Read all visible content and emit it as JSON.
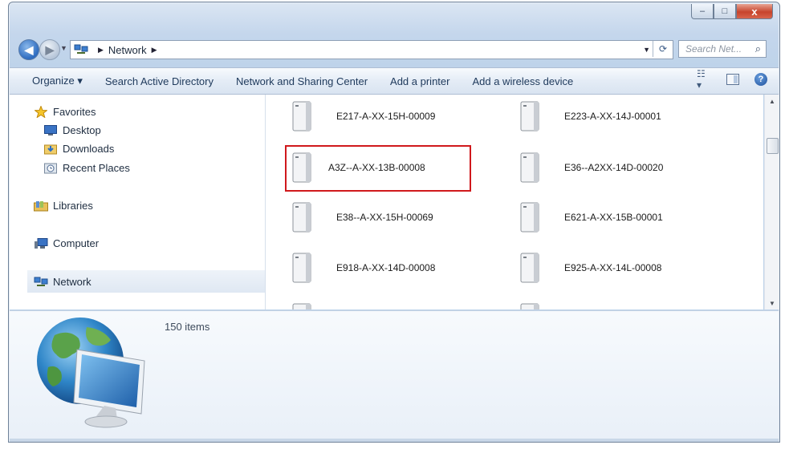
{
  "window": {
    "caption_buttons": {
      "minimize": "–",
      "maximize": "□",
      "close": "x"
    }
  },
  "navigation": {
    "back_glyph": "◀",
    "forward_glyph": "▶",
    "breadcrumb": [
      "Network"
    ],
    "search_placeholder": "Search Net...",
    "search_icon": "magnifier-icon",
    "refresh_icon": "refresh-icon"
  },
  "commands": {
    "organize": "Organize",
    "search_ad": "Search Active Directory",
    "network_sharing": "Network and Sharing Center",
    "add_printer": "Add a printer",
    "add_wireless": "Add a wireless device"
  },
  "nav_pane": {
    "favorites": "Favorites",
    "desktop": "Desktop",
    "downloads": "Downloads",
    "recent_places": "Recent Places",
    "libraries": "Libraries",
    "computer": "Computer",
    "network": "Network"
  },
  "computers": [
    {
      "name": "E217-A-XX-15H-00009"
    },
    {
      "name": "E223-A-XX-14J-00001"
    },
    {
      "name": "A3Z--A-XX-13B-00008"
    },
    {
      "name": "E36--A2XX-14D-00020"
    },
    {
      "name": "E38--A-XX-15H-00069"
    },
    {
      "name": "E621-A-XX-15B-00001"
    },
    {
      "name": "E918-A-XX-14D-00008"
    },
    {
      "name": "E925-A-XX-14L-00008"
    }
  ],
  "status": {
    "item_count": "150 items"
  },
  "colors": {
    "highlight_border": "#d0191c",
    "accent": "#1e395b"
  }
}
